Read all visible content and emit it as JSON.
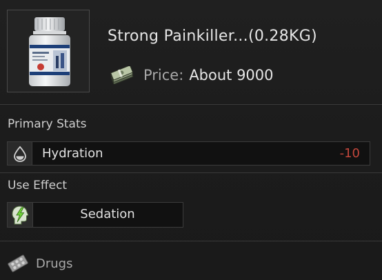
{
  "item": {
    "title": "Strong Painkiller...(0.28KG)",
    "price_label": "Price:",
    "price_value": "About 9000",
    "image_icon": "pill-bottle-icon",
    "price_icon": "cash-stack-icon"
  },
  "primary_stats": {
    "heading": "Primary Stats",
    "stats": [
      {
        "icon": "water-drop-icon",
        "name": "Hydration",
        "value": "-10"
      }
    ]
  },
  "use_effect": {
    "heading": "Use Effect",
    "effects": [
      {
        "icon": "lightning-head-icon",
        "name": "Sedation"
      }
    ]
  },
  "category": {
    "icon": "pill-pack-icon",
    "label": "Drugs"
  },
  "colors": {
    "background": "#1b1b1b",
    "text": "#e2e2e2",
    "muted_text": "#a9a9a9",
    "negative_value": "#c4473c",
    "effect_accent": "#6fd13a"
  }
}
